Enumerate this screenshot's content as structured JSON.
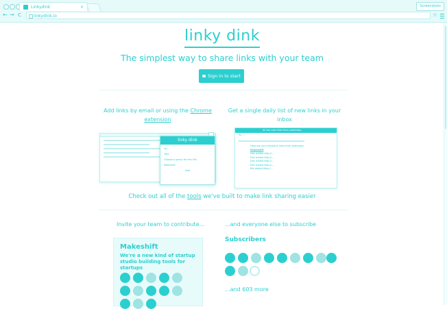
{
  "browser": {
    "tab_title": "Linkydink",
    "tab_close": "×",
    "address": "linkydink.io",
    "extension_label": "Screenshots",
    "back": "←",
    "forward": "→",
    "reload": "C",
    "star": "☆"
  },
  "hero": {
    "logo": "linky dink",
    "tagline": "The simplest way to share links with your team",
    "signin_label": "Sign in to start"
  },
  "features": {
    "left_text": "Add links by email or using the ",
    "left_link": "Chrome extension",
    "right_text": "Get a single daily list of new links in your inbox"
  },
  "popup": {
    "title": "linky dink",
    "field1": "Url",
    "field2": "Title",
    "field3": "Choose a group for this link",
    "field4": "Makeshift",
    "field5": "Add"
  },
  "email": {
    "subject": "All the new links from yesterday",
    "to": "To: ...",
    "greeting": "Here are your linkydink links from yesterday:",
    "group": "Makeshift",
    "rows": [
      "Dan added http://...",
      "Dan added http://...",
      "Dan added http://...",
      "Dan added http://...",
      "Nik added http://..."
    ]
  },
  "cta": {
    "before": "Check out all of the ",
    "link": "tools",
    "after": " we've built to make link sharing easier"
  },
  "team": {
    "invite_label": "Invite your team to contribute...",
    "everyone_label": "...and everyone else to subscribe",
    "card_title": "Makeshift",
    "card_desc": "We're a new kind of startup studio building tools for startups",
    "subscribers_heading": "Subscribers",
    "more_label": "...and 603 more"
  },
  "colors": {
    "accent": "#2ccfcf",
    "card_bg": "#e8fbfb"
  }
}
